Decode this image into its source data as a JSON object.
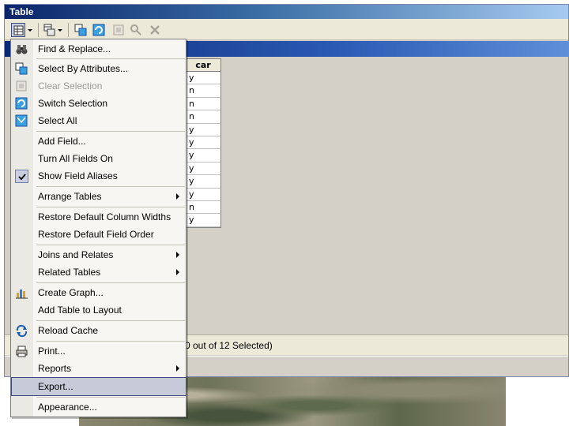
{
  "window": {
    "title": "Table"
  },
  "table": {
    "column_header": "car",
    "cells": [
      "y",
      "n",
      "n",
      "n",
      "y",
      "y",
      "y",
      "y",
      "y",
      "y",
      "n",
      "y"
    ]
  },
  "status": {
    "selection_text": "0 out of 12 Selected)"
  },
  "menu": {
    "items": [
      {
        "label": "Find & Replace...",
        "icon": "binoculars-icon"
      },
      {
        "label": "Select By Attributes...",
        "icon": "select-by-attributes-icon"
      },
      {
        "label": "Clear Selection",
        "icon": "clear-selection-icon",
        "disabled": true
      },
      {
        "label": "Switch Selection",
        "icon": "switch-selection-icon"
      },
      {
        "label": "Select All",
        "icon": "select-all-icon"
      },
      {
        "label": "Add Field..."
      },
      {
        "label": "Turn All Fields On"
      },
      {
        "label": "Show Field Aliases",
        "icon": "check-icon",
        "checked": true
      },
      {
        "label": "Arrange Tables",
        "submenu": true
      },
      {
        "label": "Restore Default Column Widths"
      },
      {
        "label": "Restore Default Field Order"
      },
      {
        "label": "Joins and Relates",
        "submenu": true
      },
      {
        "label": "Related Tables",
        "submenu": true
      },
      {
        "label": "Create Graph...",
        "icon": "bar-chart-icon"
      },
      {
        "label": "Add Table to Layout"
      },
      {
        "label": "Reload Cache",
        "icon": "reload-icon"
      },
      {
        "label": "Print...",
        "icon": "printer-icon"
      },
      {
        "label": "Reports",
        "submenu": true
      },
      {
        "label": "Export...",
        "highlighted": true
      },
      {
        "label": "Appearance..."
      }
    ]
  },
  "colors": {
    "title_gradient_start": "#0a246a",
    "highlight": "#c6cad9"
  }
}
